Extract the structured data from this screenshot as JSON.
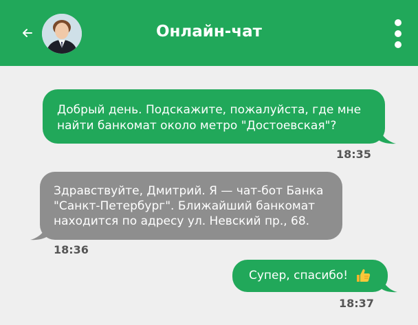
{
  "header": {
    "title": "Онлайн-чат",
    "back_icon": "arrow-left-icon",
    "menu_icon": "more-vertical-icon",
    "background": "#21a85a"
  },
  "messages": [
    {
      "side": "outgoing",
      "lines": [
        "Добрый день. Подскажите, пожалуйста, где мне",
        "найти банкомат около метро \"Достоевская\"?"
      ],
      "time": "18:35",
      "color": "#21a85a"
    },
    {
      "side": "incoming",
      "lines": [
        "Здравствуйте, Дмитрий. Я — чат-бот Банка",
        "\"Санкт-Петербург\". Ближайший банкомат",
        "находится по адресу ул. Невский пр., 68."
      ],
      "time": "18:36",
      "color": "#8e8e8e"
    },
    {
      "side": "outgoing",
      "lines": [
        "Супер, спасибо!"
      ],
      "emoji": "thumbs-up-icon",
      "time": "18:37",
      "color": "#21a85a"
    }
  ]
}
